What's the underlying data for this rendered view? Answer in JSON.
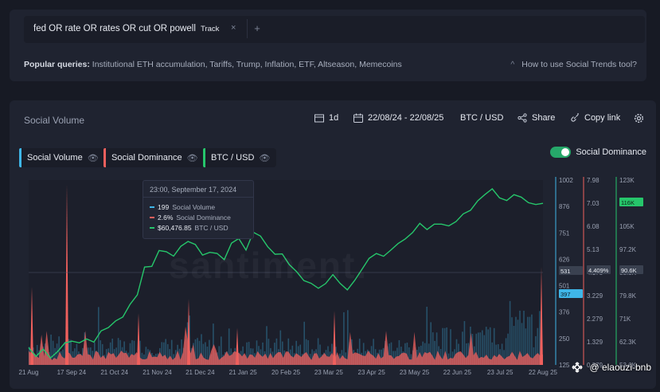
{
  "search": {
    "query": "fed OR rate OR rates OR cut OR powell",
    "track_label": "Track",
    "close_glyph": "×",
    "add_glyph": "+"
  },
  "popular": {
    "label": "Popular queries:",
    "items": [
      "Institutional ETH accumulation",
      "Tariffs",
      "Trump",
      "Inflation",
      "ETF",
      "Altseason",
      "Memecoins"
    ],
    "howto": "How to use Social Trends tool?"
  },
  "panel": {
    "title": "Social Volume",
    "interval": "1d",
    "date_range": "22/08/24 - 22/08/25",
    "pair": "BTC / USD",
    "share": "Share",
    "copy_link": "Copy link"
  },
  "metrics": [
    {
      "label": "Social Volume",
      "color": "#3fb6e8"
    },
    {
      "label": "Social Dominance",
      "color": "#f0605d"
    },
    {
      "label": "BTC / USD",
      "color": "#26c66b"
    }
  ],
  "toggle": {
    "label": "Social Dominance",
    "on": true
  },
  "tooltip": {
    "title": "23:00, September 17, 2024",
    "rows": [
      {
        "value": "199",
        "label": "Social Volume",
        "color": "#3fb6e8"
      },
      {
        "value": "2.6%",
        "label": "Social Dominance",
        "color": "#f0605d"
      },
      {
        "value": "$60,476.85",
        "label": "BTC / USD",
        "color": "#26c66b"
      }
    ]
  },
  "watermark": "santiment.",
  "handle": "@ elaouzi-bnb",
  "colors": {
    "volume": "#3fb6e8",
    "dominance": "#f0605d",
    "btc": "#26c66b",
    "background": "#1f2330"
  },
  "chart_data": {
    "type": "line",
    "x_ticks": [
      "21 Aug",
      "17 Sep 24",
      "21 Oct 24",
      "21 Nov 24",
      "21 Dec 24",
      "21 Jan 25",
      "20 Feb 25",
      "23 Mar 25",
      "23 Apr 25",
      "23 May 25",
      "22 Jun 25",
      "23 Jul 25",
      "22 Aug 25"
    ],
    "axes": [
      {
        "series": "Social Volume",
        "ticks": [
          "1002",
          "876",
          "751",
          "626",
          "501",
          "376",
          "250",
          "125"
        ],
        "badges": [
          "531",
          "397"
        ]
      },
      {
        "series": "Social Dominance",
        "ticks": [
          "7.98",
          "7.03",
          "6.08",
          "5.13",
          "4.178",
          "3.229",
          "2.279",
          "1.329",
          "0.379"
        ],
        "badges": [
          "4.409%"
        ]
      },
      {
        "series": "BTC / USD",
        "ticks": [
          "123K",
          "114K",
          "105K",
          "97.2K",
          "88.5K",
          "79.8K",
          "71K",
          "62.3K",
          "53.6K"
        ],
        "badges": [
          "116K",
          "90.6K"
        ]
      }
    ],
    "series": [
      {
        "name": "BTC / USD",
        "values": [
          60,
          57,
          59,
          56,
          58,
          61,
          63,
          62,
          64,
          63,
          66,
          67,
          70,
          72,
          76,
          80,
          90,
          91,
          97,
          96,
          95,
          98,
          100,
          98,
          94,
          95,
          96,
          94,
          99,
          101,
          97,
          104,
          102,
          98,
          96,
          95,
          92,
          88,
          85,
          84,
          83,
          85,
          87,
          84,
          82,
          86,
          89,
          94,
          96,
          95,
          97,
          99,
          101,
          104,
          106,
          105,
          107,
          106,
          105,
          108,
          110,
          112,
          115,
          118,
          119,
          117,
          116,
          118,
          117,
          114,
          113,
          114
        ]
      },
      {
        "name": "Social Dominance",
        "peaks": [
          {
            "x": "21 Aug",
            "value": 3.6
          },
          {
            "x": "17 Sep 24",
            "value": 7.8
          },
          {
            "x": "21 Nov 24",
            "value": 2.5
          },
          {
            "x": "21 Dec 24",
            "value": 3.1
          },
          {
            "x": "21 Jan 25",
            "value": 1.9
          },
          {
            "x": "23 Mar 25",
            "value": 2.6
          },
          {
            "x": "22 Aug 25",
            "value": 4.409
          }
        ]
      },
      {
        "name": "Social Volume",
        "peaks": [
          {
            "x": "21 Aug",
            "value": 180
          },
          {
            "x": "17 Sep 24",
            "value": 199
          },
          {
            "x": "23 Jul 25",
            "value": 260
          },
          {
            "x": "22 Aug 25",
            "value": 397
          }
        ]
      }
    ]
  }
}
